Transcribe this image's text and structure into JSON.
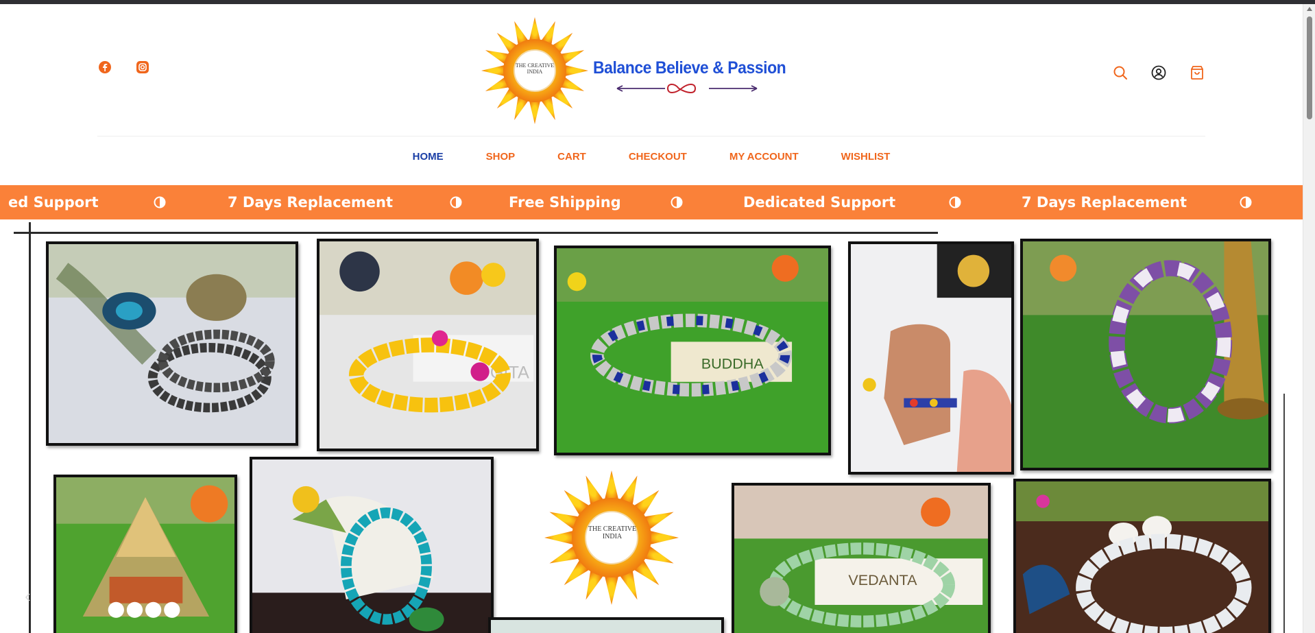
{
  "brand": {
    "logo_center_text": "THE CREATIVE INDIA",
    "tagline": "Balance Believe & Passion"
  },
  "social": {
    "facebook": "facebook-icon",
    "instagram": "instagram-icon"
  },
  "header_icons": [
    "search-icon",
    "account-icon",
    "cart-bag-icon"
  ],
  "nav": {
    "items": [
      {
        "label": "HOME",
        "active": true
      },
      {
        "label": "SHOP",
        "active": false
      },
      {
        "label": "CART",
        "active": false
      },
      {
        "label": "CHECKOUT",
        "active": false
      },
      {
        "label": "MY ACCOUNT",
        "active": false
      },
      {
        "label": "WISHLIST",
        "active": false
      }
    ]
  },
  "marquee": {
    "items": [
      "ed Support",
      "7 Days Replacement",
      "Free Shipping",
      "Dedicated Support",
      "7 Days Replacement"
    ]
  },
  "collage": {
    "photo_texts": [
      "GITA",
      "BUDDHA",
      "VEDANTA"
    ]
  },
  "colors": {
    "accent": "#f0661c",
    "marquee_bg": "#fa8139",
    "nav_active": "#1a3ea5",
    "tagline": "#1f4fd6"
  }
}
